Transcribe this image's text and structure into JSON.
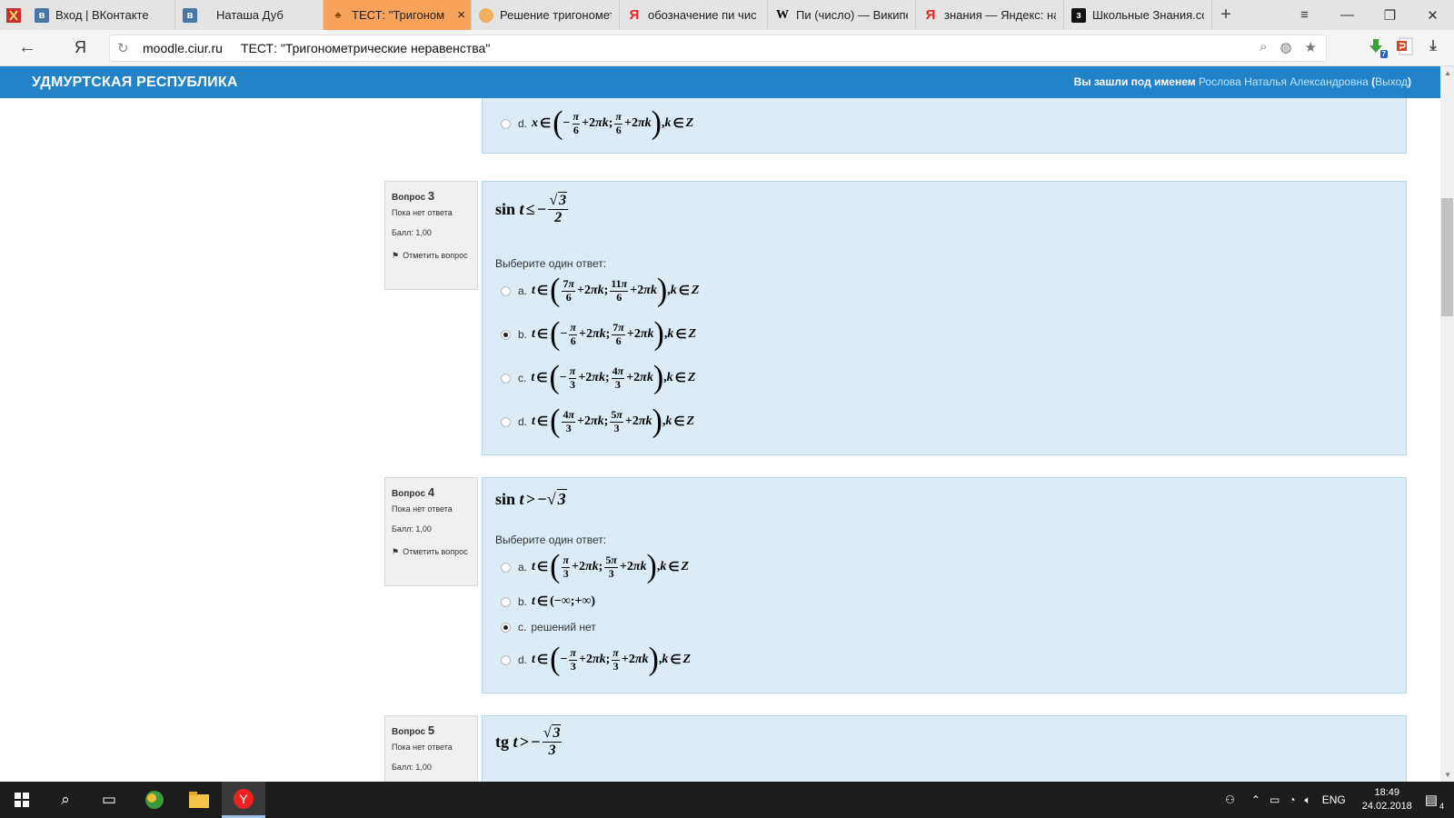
{
  "browser": {
    "tabs": [
      {
        "label": "Вход | ВКонтакте",
        "icon": "vk-icon"
      },
      {
        "label": "Наташа Дуб",
        "icon": "vk-icon"
      },
      {
        "label": "ТЕСТ: \"Тригоном",
        "icon": "moodle-icon",
        "active": true
      },
      {
        "label": "Решение тригономет",
        "icon": "egg-icon"
      },
      {
        "label": "обозначение пи чис",
        "icon": "yandex-icon"
      },
      {
        "label": "Пи (число) — Википе",
        "icon": "wikipedia-icon"
      },
      {
        "label": "знания — Яндекс: на",
        "icon": "yandex-icon"
      },
      {
        "label": "Школьные Знания.co",
        "icon": "znanija-icon"
      }
    ],
    "address": {
      "domain": "moodle.ciur.ru",
      "title": "ТЕСТ: \"Тригонометрические неравенства\"",
      "yandex_logo": "Я"
    },
    "extension_badges": {
      "downloads": "7"
    }
  },
  "site": {
    "region": "УДМУРТСКАЯ РЕСПУБЛИКА",
    "login_prefix": "Вы зашли под именем",
    "user": "Рослова Наталья Александровна",
    "logout": "Выход"
  },
  "common": {
    "prompt": "Выберите один ответ:",
    "status": "Пока нет ответа",
    "score": "Балл: 1,00",
    "flag": "Отметить вопрос",
    "question_word": "Вопрос"
  },
  "questions": {
    "q2_tail": {
      "letter": "d.",
      "selected": false
    },
    "q3": {
      "number": "3",
      "answers": [
        {
          "letter": "a.",
          "selected": false
        },
        {
          "letter": "b.",
          "selected": true
        },
        {
          "letter": "c.",
          "selected": false
        },
        {
          "letter": "d.",
          "selected": false
        }
      ]
    },
    "q4": {
      "number": "4",
      "answers": [
        {
          "letter": "a.",
          "selected": false
        },
        {
          "letter": "b.",
          "selected": false
        },
        {
          "letter": "c.",
          "text": "решений нет",
          "selected": true
        },
        {
          "letter": "d.",
          "selected": false
        }
      ]
    },
    "q5": {
      "number": "5"
    }
  },
  "taskbar": {
    "lang": "ENG",
    "time": "18:49",
    "date": "24.02.2018",
    "notifications": "4"
  }
}
